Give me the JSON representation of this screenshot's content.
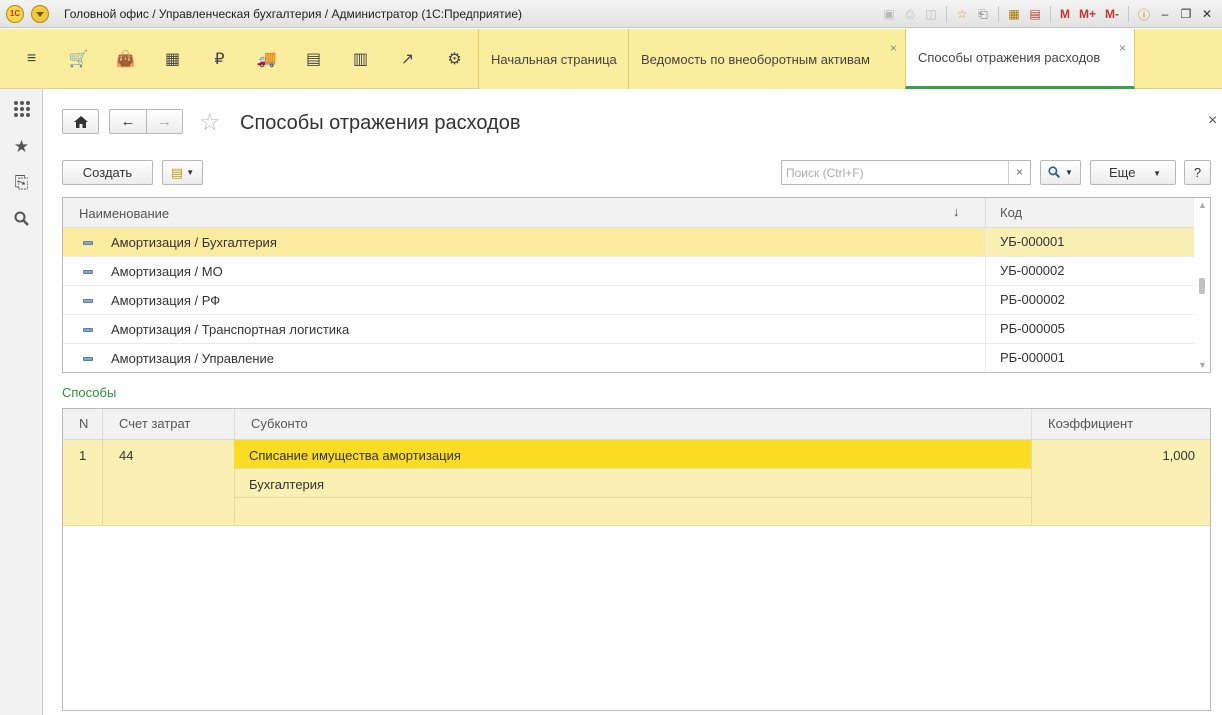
{
  "window": {
    "title": "Головной офис / Управленческая бухгалтерия / Администратор  (1С:Предприятие)",
    "logo_text": "1С",
    "toolbar_labels": {
      "m": "M",
      "m_plus": "M+",
      "m_minus": "M-"
    }
  },
  "sections": [
    {
      "icon": "menu-icon",
      "glyph": "≡"
    },
    {
      "icon": "cart-icon",
      "glyph": "🛒"
    },
    {
      "icon": "bag-icon",
      "glyph": "👜"
    },
    {
      "icon": "grid-icon",
      "glyph": "▦"
    },
    {
      "icon": "ruble-icon",
      "glyph": "₽"
    },
    {
      "icon": "truck-icon",
      "glyph": "🚚"
    },
    {
      "icon": "documents-icon",
      "glyph": "▤"
    },
    {
      "icon": "bar-chart-icon",
      "glyph": "▥"
    },
    {
      "icon": "trend-icon",
      "glyph": "↗"
    },
    {
      "icon": "gear-icon",
      "glyph": "⚙"
    }
  ],
  "tabs": [
    {
      "label": "Начальная страница",
      "closable": false,
      "active": false
    },
    {
      "label": "Ведомость по внеоборотным активам",
      "closable": true,
      "active": false
    },
    {
      "label": "Способы отражения расходов",
      "closable": true,
      "active": true
    }
  ],
  "left_panel": [
    {
      "icon": "apps-grid-icon",
      "glyph": "▦"
    },
    {
      "icon": "favorites-star-icon",
      "glyph": "★"
    },
    {
      "icon": "history-icon",
      "glyph": "⎘"
    },
    {
      "icon": "search-icon",
      "glyph": "⌕"
    }
  ],
  "form": {
    "title": "Способы отражения расходов",
    "create_label": "Создать",
    "search_placeholder": "Поиск (Ctrl+F)",
    "more_label": "Еще",
    "help_label": "?",
    "close_glyph": "×"
  },
  "list": {
    "columns": {
      "name": "Наименование",
      "code": "Код"
    },
    "rows": [
      {
        "name": "Амортизация / Бухгалтерия",
        "code": "УБ-000001",
        "selected": true
      },
      {
        "name": "Амортизация / МО",
        "code": "УБ-000002",
        "selected": false
      },
      {
        "name": "Амортизация / РФ",
        "code": "РБ-000002",
        "selected": false
      },
      {
        "name": "Амортизация / Транспортная логистика",
        "code": "РБ-000005",
        "selected": false
      },
      {
        "name": "Амортизация / Управление",
        "code": "РБ-000001",
        "selected": false
      }
    ]
  },
  "methods": {
    "caption": "Способы",
    "columns": {
      "n": "N",
      "account": "Счет затрат",
      "subconto": "Субконто",
      "coef": "Коэффициент"
    },
    "rows": [
      {
        "n": "1",
        "account": "44",
        "subconto": [
          "Списание имущества амортизация",
          "Бухгалтерия",
          ""
        ],
        "coef": "1,000"
      }
    ]
  }
}
